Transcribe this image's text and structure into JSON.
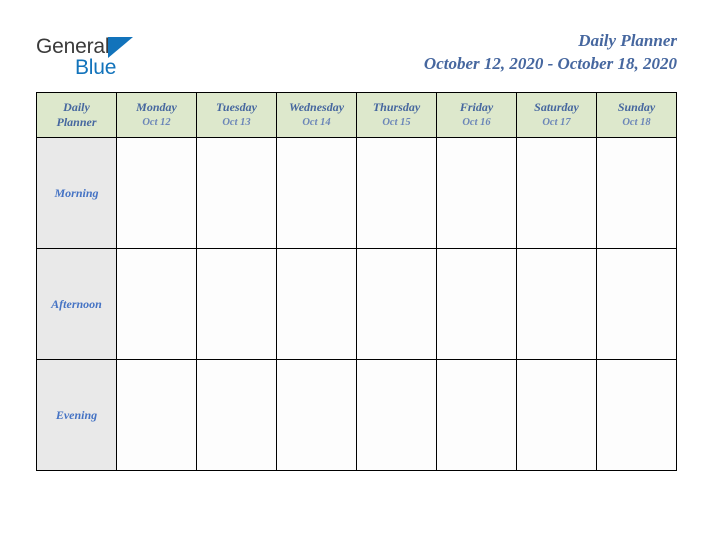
{
  "brand": {
    "name_part1": "General",
    "name_part2": "Blue",
    "triangle_icon": "triangle-icon",
    "accent_color": "#1273bb"
  },
  "header": {
    "title": "Daily Planner",
    "date_range": "October 12, 2020 - October 18, 2020",
    "title_color": "#46679f"
  },
  "table": {
    "corner": {
      "line1": "Daily",
      "line2": "Planner"
    },
    "header_bg": "#dde8cc",
    "row_label_bg": "#e9e9e9",
    "border_color": "#000000",
    "columns": [
      {
        "day": "Monday",
        "date": "Oct 12"
      },
      {
        "day": "Tuesday",
        "date": "Oct 13"
      },
      {
        "day": "Wednesday",
        "date": "Oct 14"
      },
      {
        "day": "Thursday",
        "date": "Oct 15"
      },
      {
        "day": "Friday",
        "date": "Oct 16"
      },
      {
        "day": "Saturday",
        "date": "Oct 17"
      },
      {
        "day": "Sunday",
        "date": "Oct 18"
      }
    ],
    "rows": [
      {
        "label": "Morning",
        "cells": [
          "",
          "",
          "",
          "",
          "",
          "",
          ""
        ]
      },
      {
        "label": "Afternoon",
        "cells": [
          "",
          "",
          "",
          "",
          "",
          "",
          ""
        ]
      },
      {
        "label": "Evening",
        "cells": [
          "",
          "",
          "",
          "",
          "",
          "",
          ""
        ]
      }
    ]
  }
}
